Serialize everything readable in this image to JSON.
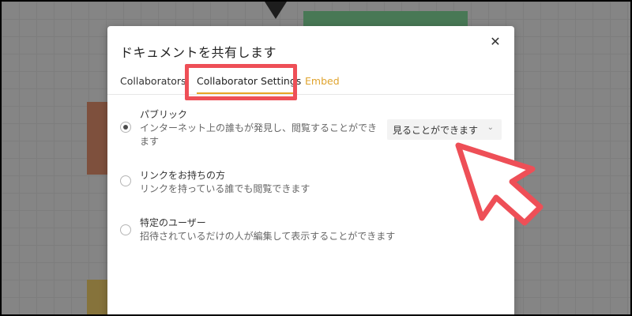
{
  "modal": {
    "title": "ドキュメントを共有します",
    "close_icon": "close-icon"
  },
  "tabs": [
    {
      "label": "Collaborators",
      "active": false
    },
    {
      "label": "Collaborator Settings",
      "active": true
    },
    {
      "label": "Embed",
      "active": false
    }
  ],
  "options": [
    {
      "title": "パブリック",
      "desc": "インターネット上の誰もが発見し、閲覧することができます",
      "selected": true
    },
    {
      "title": "リンクをお持ちの方",
      "desc": "リンクを持っている誰でも閲覧できます",
      "selected": false
    },
    {
      "title": "特定のユーザー",
      "desc": "招待されているだけの人が編集して表示することができます",
      "selected": false
    }
  ],
  "permission_select": {
    "value": "見ることができます",
    "icon": "chevron-down-icon"
  },
  "colors": {
    "accent_tab": "#e8a526",
    "annotation_red": "#ee4f57"
  }
}
